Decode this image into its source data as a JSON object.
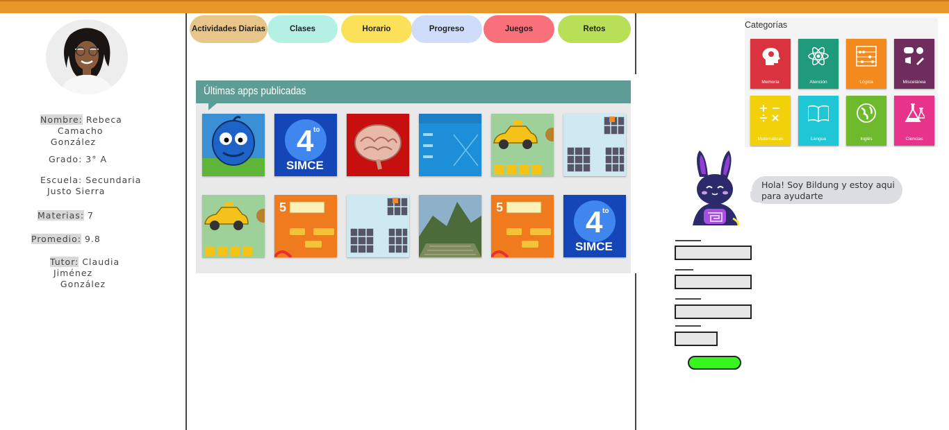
{
  "profile": {
    "name_label": "Nombre:",
    "name_value": "Rebeca\n     Camacho\n   González",
    "grade_label": "Grado:",
    "grade_value": "3° A",
    "school_label": "Escuela:",
    "school_value": "Secundaria\n  Justo Sierra",
    "subjects_label": "Materias:",
    "subjects_value": "7",
    "average_label": "Promedio:",
    "average_value": "9.8",
    "tutor_label": "Tutor:",
    "tutor_value": "Claudia\n Jiménez\n   González"
  },
  "tabs": [
    {
      "label": "Actividades Diarias",
      "color": "#e8c68a"
    },
    {
      "label": "Clases",
      "color": "#b4f0e3"
    },
    {
      "label": "Horario",
      "color": "#fbe05a"
    },
    {
      "label": "Progreso",
      "color": "#cfdcfa"
    },
    {
      "label": "Juegos",
      "color": "#f96f7a"
    },
    {
      "label": "Retos",
      "color": "#b9df58"
    }
  ],
  "apps": {
    "title": "Últimas apps publicadas",
    "row1": [
      {
        "icon": "blue-character-icon",
        "text": ""
      },
      {
        "icon": "simce-icon",
        "text": "4° SIMCE"
      },
      {
        "icon": "brain-icon",
        "text": ""
      },
      {
        "icon": "map-quiz-icon",
        "text": ""
      },
      {
        "icon": "taxi-icon",
        "text": ""
      },
      {
        "icon": "grid-puzzle-icon",
        "text": ""
      }
    ],
    "row2": [
      {
        "icon": "taxi-icon",
        "text": ""
      },
      {
        "icon": "number-game-icon",
        "text": "5"
      },
      {
        "icon": "grid-puzzle-icon",
        "text": ""
      },
      {
        "icon": "machu-picchu-icon",
        "text": ""
      },
      {
        "icon": "number-game-icon",
        "text": "5"
      },
      {
        "icon": "simce-icon",
        "text": "4° SIMCE"
      }
    ],
    "simce_num": "4",
    "simce_sup": "to",
    "simce_word": "SIMCE",
    "number_game_num": "5"
  },
  "categories": {
    "title": "Categorías",
    "items": [
      {
        "label": "Memoria",
        "color": "#d93340",
        "icon": "head-icon"
      },
      {
        "label": "Atención",
        "color": "#1f9a7c",
        "icon": "atom-icon"
      },
      {
        "label": "Lógica",
        "color": "#f28a1d",
        "icon": "abacus-icon"
      },
      {
        "label": "Miscelánea",
        "color": "#6e2d5c",
        "icon": "gamepad-icon"
      },
      {
        "label": "Matemáticas",
        "color": "#f2d10a",
        "icon": "math-icon"
      },
      {
        "label": "Lengua",
        "color": "#1ec6d6",
        "icon": "book-icon"
      },
      {
        "label": "Inglés",
        "color": "#6fba2c",
        "icon": "globe-icon"
      },
      {
        "label": "Ciencias",
        "color": "#e8338a",
        "icon": "flask-icon"
      }
    ]
  },
  "chat": {
    "message": "Hola! Soy Bildung y estoy aqui para ayudarte"
  },
  "colors": {
    "topbar": "#e8952a",
    "submit_button": "#39f51f"
  }
}
